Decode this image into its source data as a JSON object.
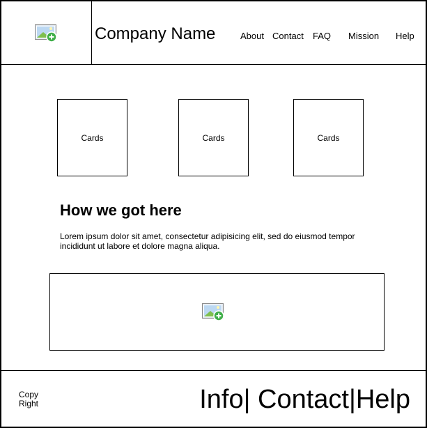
{
  "header": {
    "logo_icon": "image-add-icon",
    "company_name": "Company Name",
    "nav": [
      "About",
      "Contact",
      "FAQ",
      "Mission",
      "Help"
    ]
  },
  "cards": [
    "Cards",
    "Cards",
    "Cards"
  ],
  "section": {
    "heading": "How we got here",
    "body": "Lorem ipsum dolor sit amet, consectetur adipisicing elit, sed do eiusmod tempor incididunt ut labore et dolore magna aliqua."
  },
  "media": {
    "icon": "image-add-icon"
  },
  "footer": {
    "copyright": "Copy Right",
    "links": "Info| Contact|Help"
  },
  "colors": {
    "border": "#000000",
    "background": "#ffffff",
    "icon_green": "#3fae49"
  }
}
